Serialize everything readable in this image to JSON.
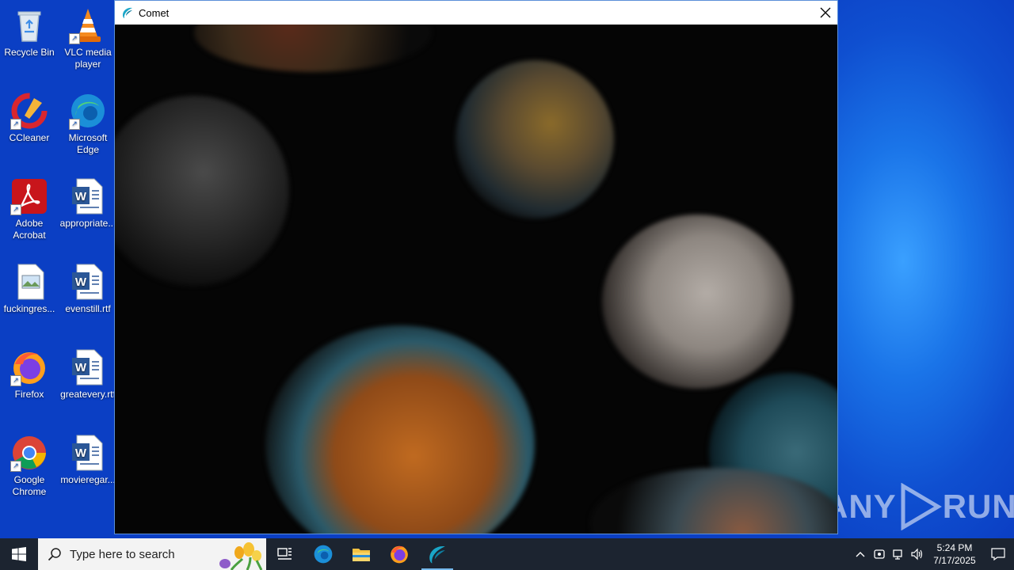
{
  "desktop": {
    "icons": [
      {
        "label": "Recycle Bin",
        "icon": "recycle-bin-icon"
      },
      {
        "label": "VLC media player",
        "icon": "vlc-icon"
      },
      {
        "label": "CCleaner",
        "icon": "ccleaner-icon"
      },
      {
        "label": "Microsoft Edge",
        "icon": "edge-icon"
      },
      {
        "label": "Adobe Acrobat",
        "icon": "acrobat-icon"
      },
      {
        "label": "appropriate...",
        "icon": "word-doc-icon"
      },
      {
        "label": "fuckingres...",
        "icon": "image-file-icon"
      },
      {
        "label": "evenstill.rtf",
        "icon": "word-doc-icon"
      },
      {
        "label": "Firefox",
        "icon": "firefox-icon"
      },
      {
        "label": "greatevery.rtf",
        "icon": "word-doc-icon"
      },
      {
        "label": "Google Chrome",
        "icon": "chrome-icon"
      },
      {
        "label": "movieregar...",
        "icon": "word-doc-icon"
      }
    ]
  },
  "window": {
    "title": "Comet",
    "icon": "comet-icon",
    "close_icon": "close-icon"
  },
  "watermark": {
    "text_left": "ANY",
    "text_right": "RUN"
  },
  "taskbar": {
    "search_placeholder": "Type here to search",
    "pinned": [
      "task-view-icon",
      "edge-icon",
      "file-explorer-icon",
      "firefox-icon",
      "comet-icon"
    ],
    "clock_time": "5:24 PM",
    "clock_date": "7/17/2025"
  },
  "colors": {
    "accent": "#0b3fc4",
    "taskbar": "#1c2430",
    "active_indicator": "#76b9ed"
  }
}
